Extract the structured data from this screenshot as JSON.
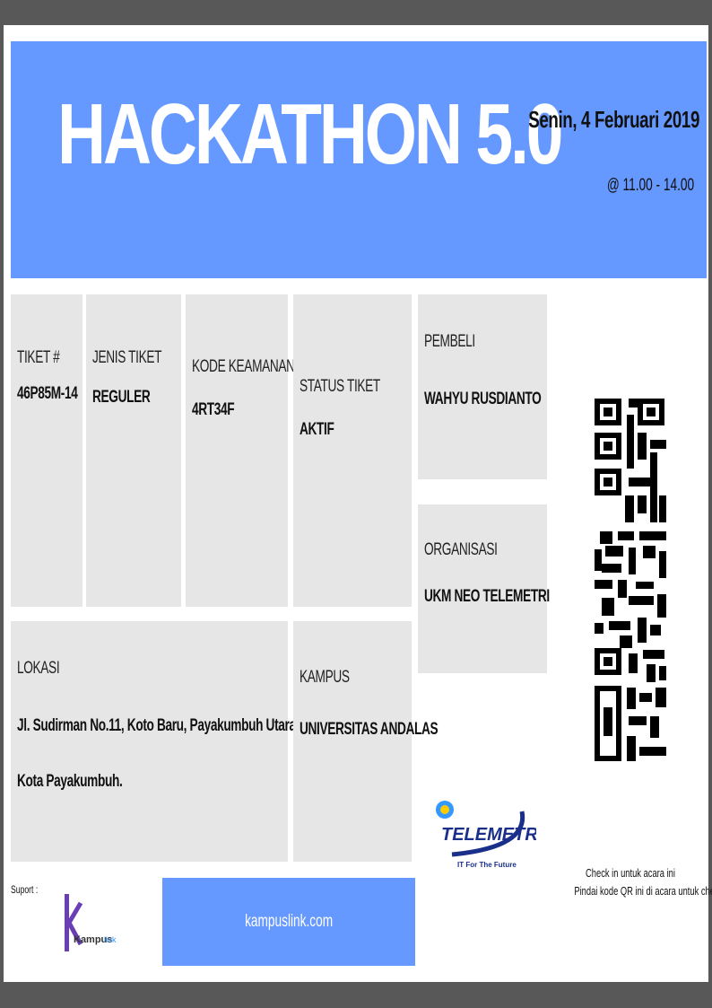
{
  "event": {
    "title": "HACKATHON 5.0",
    "date": "Senin, 4 Februari 2019",
    "time": "@ 11.00 - 14.00"
  },
  "ticket": {
    "number_label": "TIKET #",
    "number_value": "46P85M-14",
    "type_label": "JENIS TIKET",
    "type_value": "REGULER",
    "security_label": "KODE KEAMANAN",
    "security_value": "4RT34F",
    "status_label": "STATUS TIKET",
    "status_value": "AKTIF"
  },
  "buyer": {
    "label": "PEMBELI",
    "value": "WAHYU RUSDIANTO"
  },
  "organization": {
    "label": "ORGANISASI",
    "value": "UKM NEO TELEMETRI"
  },
  "location": {
    "label": "LOKASI",
    "line1": "Jl. Sudirman No.11, Koto Baru, Payakumbuh Utara,",
    "line2": "Kota Payakumbuh."
  },
  "campus": {
    "label": "KAMPUS",
    "value": "UNIVERSITAS ANDALAS"
  },
  "checkin": {
    "line1": "Check in untuk acara ini",
    "line2": "Pindai kode QR ini di acara untuk check in."
  },
  "support": {
    "label": "Suport :",
    "logo_kampus": "Kampus",
    "logo_link": "link",
    "website": "kampuslink.com"
  },
  "organizer_logo": {
    "name": "TELEMETRI",
    "tagline": "IT For The Future"
  },
  "colors": {
    "accent": "#6699ff",
    "cell": "#e6e6e6",
    "frame": "#585858"
  },
  "icons": [
    "qr-code-icon",
    "kampuslink-logo",
    "telemetri-logo"
  ]
}
